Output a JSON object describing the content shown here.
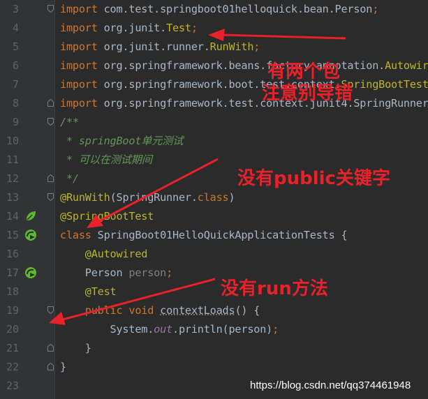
{
  "editor": {
    "lines": [
      {
        "n": "3",
        "segments": [
          {
            "t": "import",
            "c": "kw"
          },
          {
            "t": " com.test.springboot01helloquick.bean.Person",
            "c": "pl"
          },
          {
            "t": ";",
            "c": "kw"
          }
        ]
      },
      {
        "n": "4",
        "segments": [
          {
            "t": "import",
            "c": "kw"
          },
          {
            "t": " org.junit.",
            "c": "pl"
          },
          {
            "t": "Test",
            "c": "ann"
          },
          {
            "t": ";",
            "c": "kw"
          }
        ]
      },
      {
        "n": "5",
        "segments": [
          {
            "t": "import",
            "c": "kw"
          },
          {
            "t": " org.junit.runner.",
            "c": "pl"
          },
          {
            "t": "RunWith",
            "c": "ann"
          },
          {
            "t": ";",
            "c": "kw"
          }
        ]
      },
      {
        "n": "6",
        "segments": [
          {
            "t": "import",
            "c": "kw"
          },
          {
            "t": " org.springframework.beans.factory.annotation.",
            "c": "pl"
          },
          {
            "t": "Autowired",
            "c": "ann"
          }
        ]
      },
      {
        "n": "7",
        "segments": [
          {
            "t": "import",
            "c": "kw"
          },
          {
            "t": " org.springframework.boot.test.context.",
            "c": "pl"
          },
          {
            "t": "SpringBootTest",
            "c": "ann"
          }
        ]
      },
      {
        "n": "8",
        "segments": [
          {
            "t": "import",
            "c": "kw"
          },
          {
            "t": " org.springframework.test.context.junit4.SpringRunner",
            "c": "pl"
          }
        ]
      },
      {
        "n": "9",
        "segments": [
          {
            "t": "/**",
            "c": "cm"
          }
        ]
      },
      {
        "n": "10",
        "segments": [
          {
            "t": " * springBoot单元测试",
            "c": "cm"
          }
        ]
      },
      {
        "n": "11",
        "segments": [
          {
            "t": " * 可以在测试期间",
            "c": "cm"
          }
        ]
      },
      {
        "n": "12",
        "segments": [
          {
            "t": " */",
            "c": "cm"
          }
        ]
      },
      {
        "n": "13",
        "segments": [
          {
            "t": "@RunWith",
            "c": "ann"
          },
          {
            "t": "(SpringRunner.",
            "c": "pl"
          },
          {
            "t": "class",
            "c": "kw"
          },
          {
            "t": ")",
            "c": "pl"
          }
        ]
      },
      {
        "n": "14",
        "segments": [
          {
            "t": "@SpringBootTest",
            "c": "ann"
          }
        ]
      },
      {
        "n": "15",
        "segments": [
          {
            "t": "class",
            "c": "kw"
          },
          {
            "t": " SpringBoot01HelloQuickApplicationTests {",
            "c": "pl"
          }
        ]
      },
      {
        "n": "16",
        "segments": [
          {
            "t": "    ",
            "c": "pl"
          },
          {
            "t": "@Autowired",
            "c": "ann"
          }
        ]
      },
      {
        "n": "17",
        "segments": [
          {
            "t": "    Person ",
            "c": "pl"
          },
          {
            "t": "person",
            "c": "unused"
          },
          {
            "t": ";",
            "c": "kw"
          }
        ]
      },
      {
        "n": "18",
        "segments": [
          {
            "t": "    ",
            "c": "pl"
          },
          {
            "t": "@Test",
            "c": "ann"
          }
        ]
      },
      {
        "n": "19",
        "segments": [
          {
            "t": "    ",
            "c": "pl"
          },
          {
            "t": "public void",
            "c": "kw"
          },
          {
            "t": " ",
            "c": "pl"
          },
          {
            "t": "contextLoads",
            "c": "fn"
          },
          {
            "t": "() {",
            "c": "pl"
          }
        ]
      },
      {
        "n": "20",
        "segments": [
          {
            "t": "        System.",
            "c": "pl"
          },
          {
            "t": "out",
            "c": "stat"
          },
          {
            "t": ".println(person)",
            "c": "pl"
          },
          {
            "t": ";",
            "c": "kw"
          }
        ]
      },
      {
        "n": "21",
        "segments": [
          {
            "t": "    }",
            "c": "pl"
          }
        ]
      },
      {
        "n": "22",
        "segments": [
          {
            "t": "}",
            "c": "pl"
          }
        ]
      },
      {
        "n": "23",
        "segments": []
      }
    ]
  },
  "annotations": {
    "note1_line1": "有两个包",
    "note1_line2": "注意别导错",
    "note2": "没有public关键字",
    "note3": "没有run方法"
  },
  "watermark": "https://blog.csdn.net/qq374461948",
  "colors": {
    "background": "#2b2b2b",
    "gutter": "#313335",
    "keyword": "#cc7832",
    "annotation": "#bbb529",
    "comment": "#629755",
    "plain": "#a9b7c6",
    "note": "#e8212a"
  }
}
